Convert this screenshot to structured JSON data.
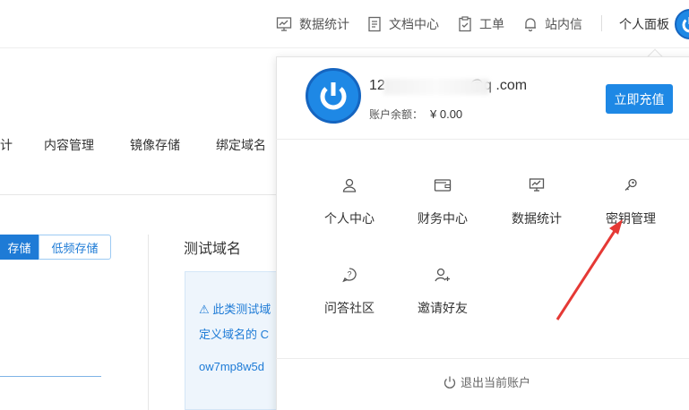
{
  "topnav": {
    "items": [
      {
        "label": "数据统计",
        "icon": "chart-icon"
      },
      {
        "label": "文档中心",
        "icon": "document-icon"
      },
      {
        "label": "工单",
        "icon": "ticket-icon"
      },
      {
        "label": "站内信",
        "icon": "bell-icon"
      }
    ],
    "panel_label": "个人面板"
  },
  "background": {
    "tabs": [
      "计",
      "内容管理",
      "镜像存储",
      "绑定域名"
    ],
    "storage_toggle": {
      "active": "存储",
      "other": "低频存储"
    },
    "section_title": "测试域名",
    "notice_lines": [
      "⚠ 此类测试域",
      "定义域名的 C",
      "ow7mp8w5d"
    ]
  },
  "dropdown": {
    "email_prefix": "12",
    "email_suffix": "@q    .com",
    "balance_label": "账户余额：",
    "balance_value": "¥ 0.00",
    "recharge_label": "立即充值",
    "grid": [
      {
        "label": "个人中心",
        "icon": "user-icon"
      },
      {
        "label": "财务中心",
        "icon": "wallet-icon"
      },
      {
        "label": "数据统计",
        "icon": "chart-icon"
      },
      {
        "label": "密钥管理",
        "icon": "key-icon"
      },
      {
        "label": "问答社区",
        "icon": "question-icon"
      },
      {
        "label": "邀请好友",
        "icon": "add-user-icon"
      }
    ],
    "logout_label": "退出当前账户"
  },
  "colors": {
    "accent": "#1e88e5",
    "annotation_arrow": "#e53935"
  }
}
